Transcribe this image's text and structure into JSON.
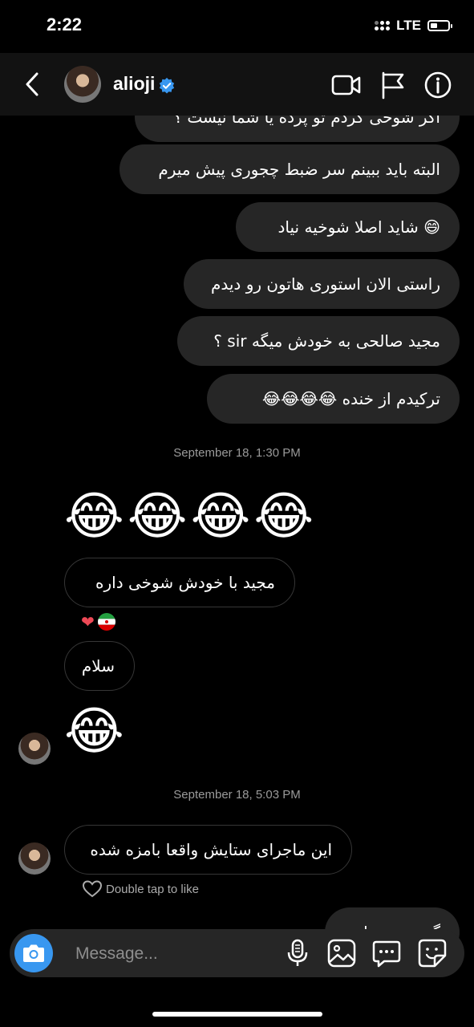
{
  "status": {
    "time": "2:22",
    "network": "LTE"
  },
  "header": {
    "username": "alioji",
    "verified": true,
    "icons": [
      "back-icon",
      "video-call-icon",
      "flag-icon",
      "info-icon"
    ]
  },
  "messages": {
    "out_partial_top": "اگر شوخی کردم تو پرده یا شما نیست ؟",
    "out1": "البته باید ببینم سر ضبط چجوری پیش میرم",
    "out2": "😄 شاید اصلا شوخیه نیاد",
    "out3": "راستی الان استوری هاتون رو دیدم",
    "out4": "مجید صالحی به خودش میگه sir ؟",
    "out5": "ترکیدم از خنده 😂😂😂😂",
    "ts1": "September 18, 1:30 PM",
    "in_emoji1": "😂😂😂😂",
    "in1": "مجید با خودش شوخی داره",
    "in1_reactions": "❤️🇮🇷",
    "in2": "سلام",
    "in_emoji2": "😂",
    "ts2": "September 18, 5:03 PM",
    "in3": "این ماجرای ستایش واقعا بامزه شده",
    "like_hint": "Double tap to like",
    "out_partial_bottom": "گفتم تو بزنا"
  },
  "composer": {
    "placeholder": "Message...",
    "icons": [
      "camera-icon",
      "microphone-icon",
      "gallery-icon",
      "chat-bubble-icon",
      "sticker-icon"
    ]
  },
  "colors": {
    "background": "#000000",
    "bubble_out": "#262626",
    "bubble_in_border": "#363636",
    "accent": "#3897f0",
    "verified": "#3897f0",
    "heart": "#ed4956"
  }
}
